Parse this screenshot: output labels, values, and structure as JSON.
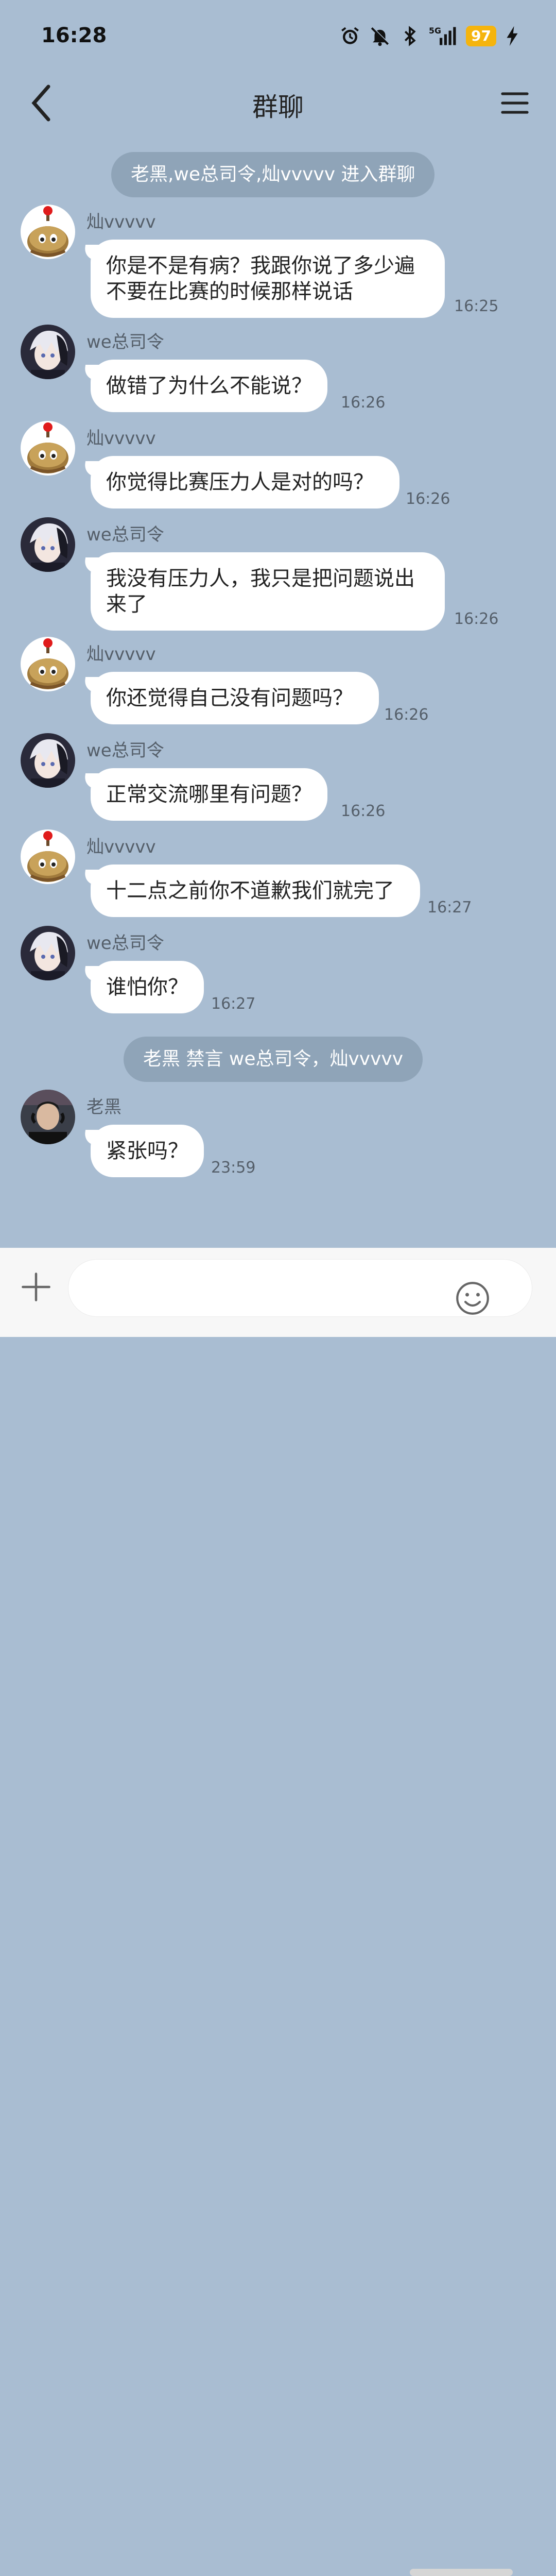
{
  "status_bar": {
    "time": "16:28",
    "icons": [
      "alarm-icon",
      "mute-icon",
      "bluetooth-icon",
      "5g-signal-icon"
    ],
    "battery": "97",
    "battery_color": "#f5b40d"
  },
  "header": {
    "title": "群聊",
    "back_icon": "chevron-left-icon",
    "menu_icon": "hamburger-menu-icon"
  },
  "system_messages": [
    "老黑,we总司令,灿vvvvv 进入群聊",
    "老黑 禁言 we总司令，灿vvvvv"
  ],
  "messages": [
    {
      "sender": "灿vvvvv",
      "lines": [
        "你是不是有病？我跟你说了多少遍",
        "不要在比赛的时候那样说话"
      ],
      "time": "16:25"
    },
    {
      "sender": "we总司令",
      "lines": [
        "做错了为什么不能说？"
      ],
      "time": "16:26"
    },
    {
      "sender": "灿vvvvv",
      "lines": [
        "你觉得比赛压力人是对的吗？"
      ],
      "time": "16:26"
    },
    {
      "sender": "we总司令",
      "lines": [
        "我没有压力人，我只是把问题说出",
        "来了"
      ],
      "time": "16:26"
    },
    {
      "sender": "灿vvvvv",
      "lines": [
        "你还觉得自己没有问题吗？"
      ],
      "time": "16:26"
    },
    {
      "sender": "we总司令",
      "lines": [
        "正常交流哪里有问题？"
      ],
      "time": "16:26"
    },
    {
      "sender": "灿vvvvv",
      "lines": [
        "十二点之前你不道歉我们就完了"
      ],
      "time": "16:27"
    },
    {
      "sender": "we总司令",
      "lines": [
        "谁怕你？"
      ],
      "time": "16:27"
    },
    {
      "sender": "老黑",
      "lines": [
        "紧张吗？"
      ],
      "time": "23:59"
    }
  ],
  "input_bar": {
    "plus_icon": "plus-icon",
    "emoji_icon": "emoji-icon",
    "placeholder": ""
  },
  "colors": {
    "background": "#a9bdd2",
    "system_pill": "#8fa4b8",
    "bubble": "#ffffff"
  }
}
